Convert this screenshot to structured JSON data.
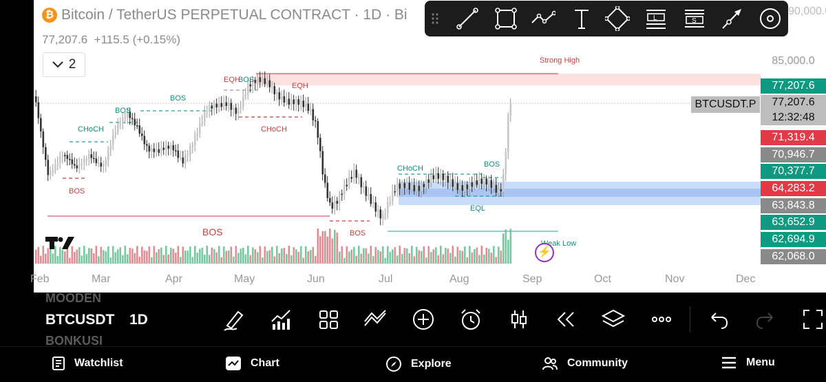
{
  "header": {
    "title": "Bitcoin / TetherUS PERPETUAL CONTRACT · 1D · Bi",
    "logo_symbol": "₿",
    "price": "77,207.6",
    "change": "+115.5 (+0.15%)",
    "interval_toggle": "2",
    "top_right_price": "90,000.0"
  },
  "drawing_toolbar": {
    "tools": [
      "drag-handle-icon",
      "trend-line-icon",
      "rectangle-icon",
      "path-icon",
      "text-icon",
      "rotated-rectangle-icon",
      "long-position-icon",
      "short-position-icon",
      "arrow-icon",
      "settings-icon"
    ],
    "labels": {
      "long": "L",
      "short": "S"
    }
  },
  "annotations": {
    "strong_high": "Strong High",
    "weak_low": "Weak Low",
    "bos": "BOS",
    "choch": "CHoCH",
    "eqh": "EQH",
    "eqhbos": "EQHBOS",
    "eql": "EQL",
    "overlap": "CHoCH"
  },
  "price_axis": {
    "top_level": "85,000.0",
    "tags": [
      {
        "value": "77,207.6",
        "color": "#0e9981"
      },
      {
        "value": "77,207.6",
        "color": "#bdbdbd"
      },
      {
        "value": "12:32:48",
        "color": "#bdbdbd"
      },
      {
        "value": "71,319.4",
        "color": "#e23b48"
      },
      {
        "value": "70,946.7",
        "color": "#8a8a8a"
      },
      {
        "value": "70,377.7",
        "color": "#0e9981"
      },
      {
        "value": "64,283.2",
        "color": "#e23b48"
      },
      {
        "value": "63,843.8",
        "color": "#8a8a8a"
      },
      {
        "value": "63,652.9",
        "color": "#0e9981"
      },
      {
        "value": "62,694.9",
        "color": "#0e9981"
      },
      {
        "value": "62,068.0",
        "color": "#8a8a8a"
      }
    ],
    "ticker": "BTCUSDT.P"
  },
  "time_axis": [
    "Feb",
    "Mar",
    "Apr",
    "May",
    "Jun",
    "Jul",
    "Aug",
    "Sep",
    "Oct",
    "Nov",
    "Dec"
  ],
  "bottom_bar": {
    "symbol_above": "MOODEN",
    "symbol": "BTCUSDT",
    "interval": "1D",
    "symbol_below": "BONKUSI",
    "tools": [
      "pencil-icon",
      "indicators-icon",
      "templates-icon",
      "compare-icon",
      "add-icon",
      "alert-clock-icon",
      "candle-type-icon",
      "replay-icon",
      "layers-icon",
      "more-icon",
      "undo-icon",
      "redo-icon",
      "fullscreen-icon"
    ]
  },
  "nav": {
    "watchlist": "Watchlist",
    "chart": "Chart",
    "explore": "Explore",
    "community": "Community",
    "menu": "Menu"
  },
  "colors": {
    "up": "#bdbdbd",
    "down": "#3a3a3a",
    "bull_vol": "#5fbf8f",
    "bear_vol": "#d97a80",
    "accent_green": "#0e9981",
    "accent_red": "#e23b48"
  }
}
